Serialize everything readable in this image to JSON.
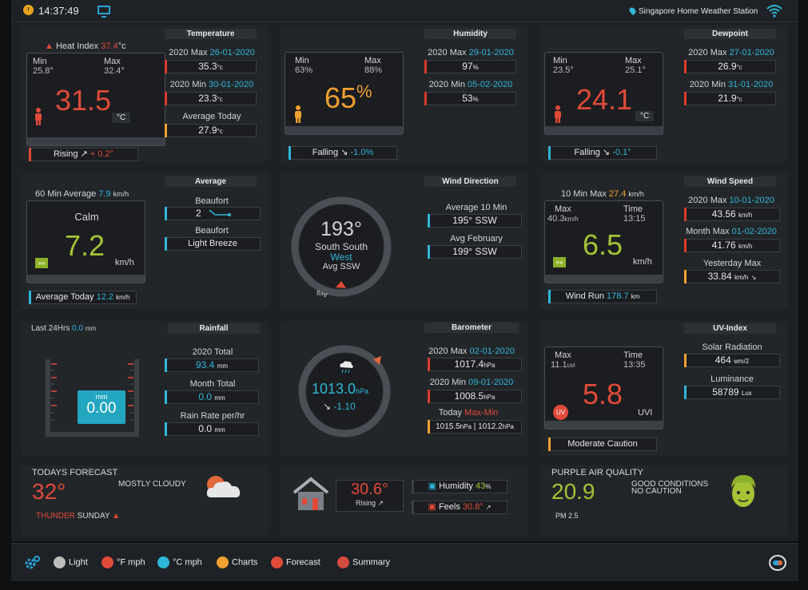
{
  "topbar": {
    "time": "14:37:49",
    "station": "Singapore Home Weather Station"
  },
  "temperature": {
    "title": "Temperature",
    "heat_index_label": "Heat Index",
    "heat_index_value": "37.4",
    "heat_index_unit": "°c",
    "min_label": "Min",
    "min_value": "25.8°",
    "max_label": "Max",
    "max_value": "32.4°",
    "current": "31.5",
    "unit": "°C",
    "trend_label": "Rising",
    "trend_value": "+ 0.2°",
    "year_max_label": "2020 Max",
    "year_max_date": "26-01-2020",
    "year_max_value": "35.3",
    "year_max_unit": "°c",
    "year_min_label": "2020 Min",
    "year_min_date": "30-01-2020",
    "year_min_value": "23.3",
    "year_min_unit": "°c",
    "avg_today_label": "Average Today",
    "avg_today_value": "27.9",
    "avg_today_unit": "°c"
  },
  "humidity": {
    "title": "Humidity",
    "min_label": "Min",
    "min_value": "63%",
    "max_label": "Max",
    "max_value": "88%",
    "current": "65",
    "unit": "%",
    "trend_label": "Falling",
    "trend_value": "-1.0%",
    "year_max_label": "2020 Max",
    "year_max_date": "29-01-2020",
    "year_max_value": "97",
    "year_max_unit": "%",
    "year_min_label": "2020 Min",
    "year_min_date": "05-02-2020",
    "year_min_value": "53",
    "year_min_unit": "%"
  },
  "dewpoint": {
    "title": "Dewpoint",
    "min_label": "Min",
    "min_value": "23.5°",
    "max_label": "Max",
    "max_value": "25.1°",
    "current": "24.1",
    "unit": "°C",
    "trend_label": "Falling",
    "trend_value": "-0.1°",
    "year_max_label": "2020 Max",
    "year_max_date": "27-01-2020",
    "year_max_value": "26.9",
    "year_max_unit": "°c",
    "year_min_label": "2020 Min",
    "year_min_date": "31-01-2020",
    "year_min_value": "21.9",
    "year_min_unit": "°c"
  },
  "average": {
    "title": "Average",
    "sixty_label": "60 Min Average",
    "sixty_value": "7.9",
    "sixty_unit": "km/h",
    "condition": "Calm",
    "current": "7.2",
    "unit": "km/h",
    "beaufort_label": "Beaufort",
    "beaufort_value": "2",
    "beaufort2_label": "Beaufort",
    "beaufort2_value": "Light Breeze",
    "avg_today_label": "Average Today",
    "avg_today_value": "12.2",
    "avg_today_unit": "km/h"
  },
  "wind_direction": {
    "title": "Wind Direction",
    "degrees": "193°",
    "line1": "South South",
    "line2": "West",
    "line3": "Avg SSW",
    "avg_marker": "Avg",
    "avg10_label": "Average 10 Min",
    "avg10_value": "195°  SSW",
    "avg_feb_label": "Avg February",
    "avg_feb_value": "199°  SSW"
  },
  "wind_speed": {
    "title": "Wind Speed",
    "ten_label": "10 Min Max",
    "ten_value": "27.4",
    "ten_unit": "km/h",
    "max_label": "Max",
    "max_value": "40.3",
    "max_unit": "km/h",
    "time_label": "Time",
    "time_value": "13:15",
    "current": "6.5",
    "unit": "km/h",
    "run_label": "Wind Run",
    "run_value": "178.7",
    "run_unit": "km",
    "year_max_label": "2020 Max",
    "year_max_date": "10-01-2020",
    "year_max_value": "43.56",
    "year_max_unit": "km/h",
    "month_max_label": "Month Max",
    "month_max_date": "01-02-2020",
    "month_max_value": "41.76",
    "month_max_unit": "km/h",
    "yday_label": "Yesterday Max",
    "yday_value": "33.84",
    "yday_unit": "km/h"
  },
  "rainfall": {
    "title": "Rainfall",
    "last24_label": "Last 24Hrs",
    "last24_value": "0.0",
    "last24_unit": "mm",
    "gauge_unit": "mm",
    "gauge_value": "0.00",
    "total_label": "2020 Total",
    "total_value": "93.4",
    "total_unit": "mm",
    "month_label": "Month Total",
    "month_value": "0.0",
    "month_unit": "mm",
    "rate_label": "Rain Rate per/hr",
    "rate_value": "0.0",
    "rate_unit": "mm"
  },
  "barometer": {
    "title": "Barometer",
    "value": "1013.0",
    "unit": "hPa",
    "trend": "-1.10",
    "year_max_label": "2020 Max",
    "year_max_date": "02-01-2020",
    "year_max_value": "1017.4",
    "year_max_unit": "hPa",
    "year_min_label": "2020 Min",
    "year_min_date": "09-01-2020",
    "year_min_value": "1008.5",
    "year_min_unit": "hPa",
    "today_label": "Today",
    "today_maxmin": "Max-Min",
    "today_max": "1015.5",
    "today_min": "1012.2",
    "today_unit": "hPa"
  },
  "uv": {
    "title": "UV-Index",
    "max_label": "Max",
    "max_value": "11.1",
    "max_unit": "uvi",
    "time_label": "Time",
    "time_value": "13:35",
    "current": "5.8",
    "unit": "UVI",
    "badge": "UV",
    "caution": "Moderate Caution",
    "solar_label": "Solar Radiation",
    "solar_value": "464",
    "solar_unit": "wm/2",
    "lum_label": "Luminance",
    "lum_value": "58789",
    "lum_unit": "Lux"
  },
  "forecast": {
    "title": "TODAYS FORECAST",
    "temp": "32°",
    "condition": "MOSTLY CLOUDY",
    "thunder": "THUNDER",
    "day": "SUNDAY"
  },
  "indoor": {
    "temp": "30.6°",
    "trend": "Rising",
    "humidity_label": "Humidity",
    "humidity_value": "43",
    "humidity_unit": "%",
    "feels_label": "Feels",
    "feels_value": "30.8°"
  },
  "air": {
    "title": "PURPLE AIR QUALITY",
    "value": "20.9",
    "line1": "GOOD CONDITIONS",
    "line2": "NO CAUTION",
    "pm": "PM 2.5"
  },
  "menu": {
    "light": "Light",
    "f_mph": "°F mph",
    "c_mph": "°C mph",
    "charts": "Charts",
    "forecast": "Forecast",
    "summary": "Summary"
  },
  "colors": {
    "accent_blue": "#2fb6d8",
    "accent_red": "#e04a39",
    "accent_orange": "#f0a030",
    "accent_green": "#a6c235"
  },
  "icons": [
    "clock-icon",
    "monitor-icon",
    "location-pin-icon",
    "wifi-icon",
    "person-icon",
    "trend-up-icon",
    "trend-down-icon",
    "calendar-icon",
    "cloud-rain-icon",
    "house-icon",
    "cloud-sun-icon",
    "face-icon",
    "gear-icon",
    "toggle-icon",
    "warning-icon"
  ]
}
